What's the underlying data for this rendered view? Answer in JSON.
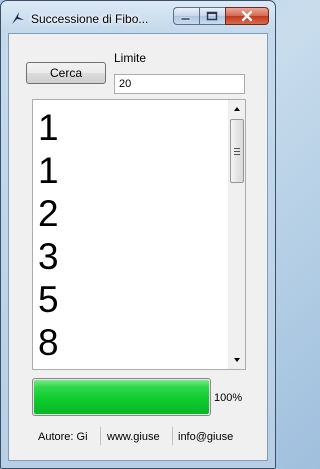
{
  "window": {
    "title": "Successione di Fibo..."
  },
  "controls": {
    "search_button": "Cerca",
    "limit_label": "Limite",
    "limit_value": "20"
  },
  "results": {
    "items": [
      "1",
      "1",
      "2",
      "3",
      "5",
      "8"
    ]
  },
  "progress": {
    "fraction": 1.0,
    "label": "100%",
    "color": "#0fcc2f"
  },
  "statusbar": {
    "author": "Autore: Gi",
    "website": "www.giuse",
    "email": "info@giuse"
  }
}
